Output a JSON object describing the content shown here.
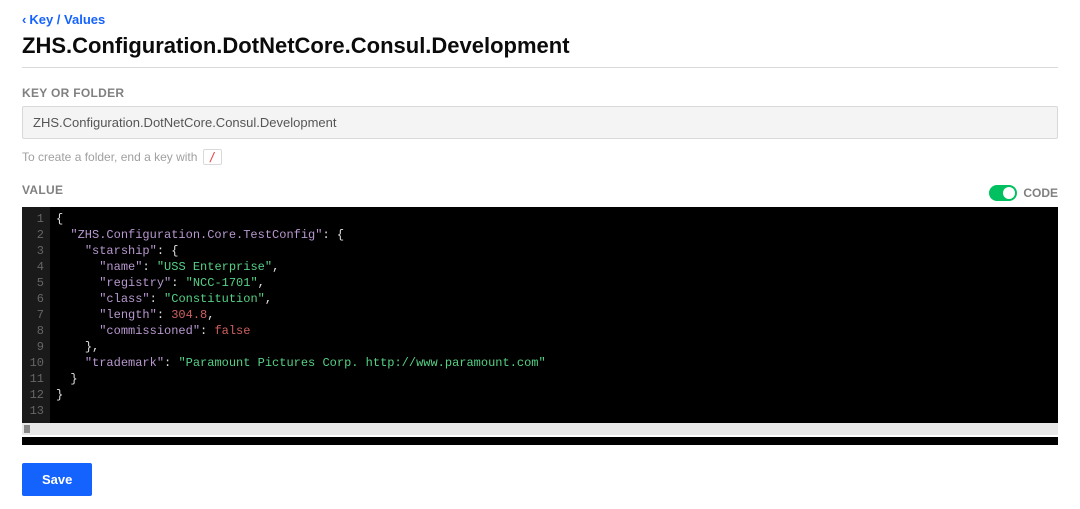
{
  "breadcrumb": {
    "label": "Key / Values"
  },
  "page": {
    "title": "ZHS.Configuration.DotNetCore.Consul.Development"
  },
  "keyField": {
    "label": "KEY OR FOLDER",
    "value": "ZHS.Configuration.DotNetCore.Consul.Development",
    "hint_prefix": "To create a folder, end a key with",
    "hint_slash": "/"
  },
  "valueField": {
    "label": "VALUE",
    "toggle_label": "CODE",
    "toggle_on": true
  },
  "code": {
    "lines": [
      {
        "n": 1,
        "tokens": [
          {
            "c": "p",
            "t": "{"
          }
        ]
      },
      {
        "n": 2,
        "tokens": [
          {
            "c": "ws",
            "t": "  "
          },
          {
            "c": "k",
            "t": "\"ZHS.Configuration.Core.TestConfig\""
          },
          {
            "c": "p",
            "t": ": {"
          }
        ]
      },
      {
        "n": 3,
        "tokens": [
          {
            "c": "ws",
            "t": "    "
          },
          {
            "c": "k",
            "t": "\"starship\""
          },
          {
            "c": "p",
            "t": ": {"
          }
        ]
      },
      {
        "n": 4,
        "tokens": [
          {
            "c": "ws",
            "t": "      "
          },
          {
            "c": "k",
            "t": "\"name\""
          },
          {
            "c": "p",
            "t": ": "
          },
          {
            "c": "s",
            "t": "\"USS Enterprise\""
          },
          {
            "c": "p",
            "t": ","
          }
        ]
      },
      {
        "n": 5,
        "tokens": [
          {
            "c": "ws",
            "t": "      "
          },
          {
            "c": "k",
            "t": "\"registry\""
          },
          {
            "c": "p",
            "t": ": "
          },
          {
            "c": "s",
            "t": "\"NCC-1701\""
          },
          {
            "c": "p",
            "t": ","
          }
        ]
      },
      {
        "n": 6,
        "tokens": [
          {
            "c": "ws",
            "t": "      "
          },
          {
            "c": "k",
            "t": "\"class\""
          },
          {
            "c": "p",
            "t": ": "
          },
          {
            "c": "s",
            "t": "\"Constitution\""
          },
          {
            "c": "p",
            "t": ","
          }
        ]
      },
      {
        "n": 7,
        "tokens": [
          {
            "c": "ws",
            "t": "      "
          },
          {
            "c": "k",
            "t": "\"length\""
          },
          {
            "c": "p",
            "t": ": "
          },
          {
            "c": "n",
            "t": "304.8"
          },
          {
            "c": "p",
            "t": ","
          }
        ]
      },
      {
        "n": 8,
        "tokens": [
          {
            "c": "ws",
            "t": "      "
          },
          {
            "c": "k",
            "t": "\"commissioned\""
          },
          {
            "c": "p",
            "t": ": "
          },
          {
            "c": "b",
            "t": "false"
          }
        ]
      },
      {
        "n": 9,
        "tokens": [
          {
            "c": "ws",
            "t": "    "
          },
          {
            "c": "p",
            "t": "},"
          }
        ]
      },
      {
        "n": 10,
        "tokens": [
          {
            "c": "ws",
            "t": "    "
          },
          {
            "c": "k",
            "t": "\"trademark\""
          },
          {
            "c": "p",
            "t": ": "
          },
          {
            "c": "s",
            "t": "\"Paramount Pictures Corp. http://www.paramount.com\""
          }
        ]
      },
      {
        "n": 11,
        "tokens": [
          {
            "c": "ws",
            "t": "  "
          },
          {
            "c": "p",
            "t": "}"
          }
        ]
      },
      {
        "n": 12,
        "tokens": [
          {
            "c": "p",
            "t": "}"
          }
        ]
      },
      {
        "n": 13,
        "tokens": []
      }
    ]
  },
  "actions": {
    "save_label": "Save"
  }
}
